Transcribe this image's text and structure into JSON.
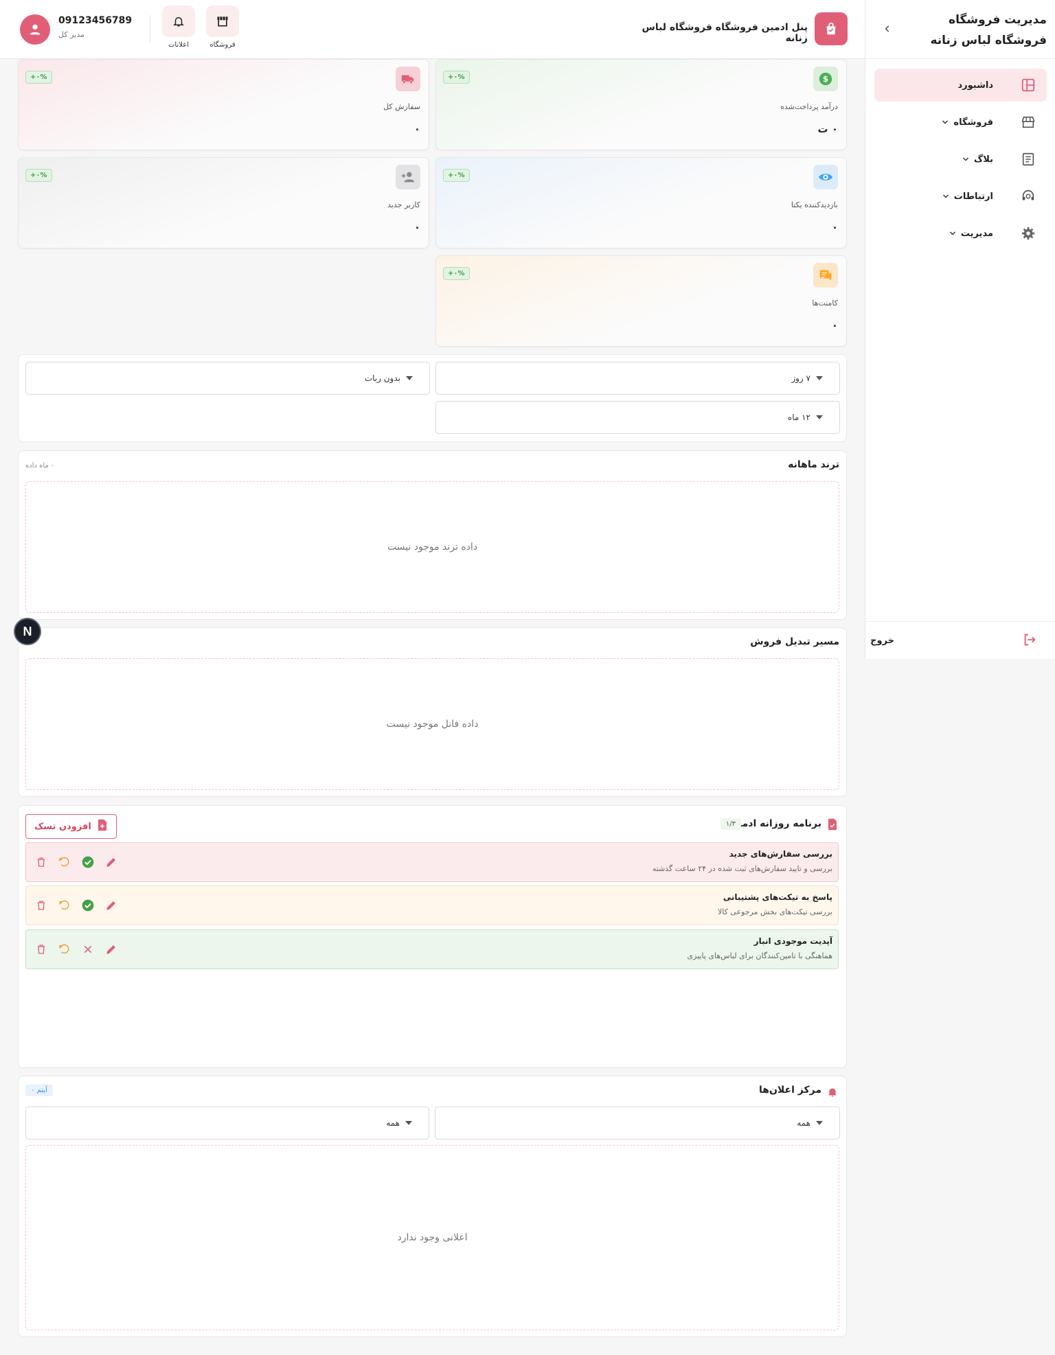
{
  "sidebar": {
    "title": "مدیریت فروشگاه فروشگاه لباس زنانه",
    "items": [
      {
        "label": "داشبورد",
        "icon": "dashboard-icon",
        "active": true
      },
      {
        "label": "فروشگاه",
        "icon": "store-icon"
      },
      {
        "label": "بلاگ",
        "icon": "article-icon"
      },
      {
        "label": "ارتباطات",
        "icon": "support-agent-icon"
      },
      {
        "label": "مدیریت",
        "icon": "gear-icon"
      }
    ],
    "logout": "خروج"
  },
  "header": {
    "title": "پنل ادمین فروشگاه فروشگاه لباس زنانه",
    "store_label": "فروشگاه",
    "notifications_label": "اعلانات",
    "user_phone": "09123456789",
    "user_role": "مدیر کل"
  },
  "stats": [
    {
      "label": "درآمد پرداخت‌شده",
      "value": "۰ ت",
      "badge": "+۰%",
      "icon": "dollar-icon",
      "color": "#4caf50"
    },
    {
      "label": "سفارش کل",
      "value": "۰",
      "badge": "+۰%",
      "icon": "truck-icon",
      "color": "#e05f77"
    },
    {
      "label": "بازدیدکننده یکتا",
      "value": "۰",
      "badge": "+۰%",
      "icon": "eye-icon",
      "color": "#42a5f5"
    },
    {
      "label": "کاربر جدید",
      "value": "۰",
      "badge": "+۰%",
      "icon": "add-user-icon",
      "color": "#9e9e9e"
    },
    {
      "label": "کامنت‌ها",
      "value": "۰",
      "badge": "+۰%",
      "icon": "comments-icon",
      "color": "#ffa726"
    }
  ],
  "filters": {
    "period": "۷ روز",
    "bots": "بدون ربات",
    "range": "۱۲ ماه"
  },
  "trend": {
    "title": "ترند ماهانه",
    "subtitle": "۰ ماه داده",
    "empty": "داده ترند موجود نیست"
  },
  "funnel": {
    "title": "مسیر تبدیل فروش",
    "empty": "داده فانل موجود نیست"
  },
  "tasks": {
    "title": "برنامه روزانه ادمین",
    "count": "۱/۳",
    "add_label": "افزودن تسک",
    "items": [
      {
        "title": "بررسی سفارش‌های جدید",
        "desc": "بررسی و تایید سفارش‌های ثبت شده در ۲۴ ساعت گذشته",
        "bg": "#fcebed",
        "border": "#f3c7ce",
        "done": false
      },
      {
        "title": "پاسخ به تیکت‌های پشتیبانی",
        "desc": "بررسی تیکت‌های بخش مرجوعی کالا",
        "bg": "#fff7ec",
        "border": "#f7e1bf",
        "done": false
      },
      {
        "title": "آپدیت موجودی انبار",
        "desc": "هماهنگی با تامین‌کنندگان برای لباس‌های پاییزی",
        "bg": "#edf6ed",
        "border": "#c5e1c6",
        "done": true
      }
    ]
  },
  "notifications": {
    "title": "مرکز اعلان‌ها",
    "count": "۰ آیتم",
    "filter_a": "همه",
    "filter_b": "همه",
    "empty": "اعلانی وجود ندارد"
  },
  "fab": "N"
}
